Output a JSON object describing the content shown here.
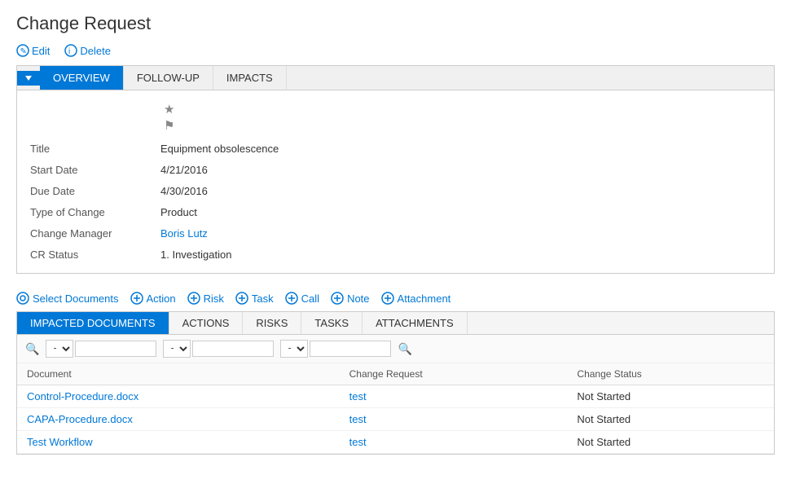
{
  "page": {
    "title": "Change Request"
  },
  "top_toolbar": {
    "edit_label": "Edit",
    "delete_label": "Delete"
  },
  "tabs": [
    {
      "id": "overview",
      "label": "OVERVIEW",
      "active": true
    },
    {
      "id": "followup",
      "label": "FOLLOW-UP",
      "active": false
    },
    {
      "id": "impacts",
      "label": "IMPACTS",
      "active": false
    }
  ],
  "overview": {
    "fields": [
      {
        "label": "Title",
        "value": "Equipment obsolescence",
        "type": "text"
      },
      {
        "label": "Start Date",
        "value": "4/21/2016",
        "type": "text"
      },
      {
        "label": "Due Date",
        "value": "4/30/2016",
        "type": "text"
      },
      {
        "label": "Type of Change",
        "value": "Product",
        "type": "text"
      },
      {
        "label": "Change Manager",
        "value": "Boris Lutz",
        "type": "link"
      },
      {
        "label": "CR Status",
        "value": "1. Investigation",
        "type": "text"
      }
    ]
  },
  "action_bar": {
    "select_documents_label": "Select Documents",
    "action_label": "Action",
    "risk_label": "Risk",
    "task_label": "Task",
    "call_label": "Call",
    "note_label": "Note",
    "attachment_label": "Attachment"
  },
  "sub_tabs": [
    {
      "id": "impacted",
      "label": "IMPACTED DOCUMENTS",
      "active": true
    },
    {
      "id": "actions",
      "label": "ACTIONS",
      "active": false
    },
    {
      "id": "risks",
      "label": "RISKS",
      "active": false
    },
    {
      "id": "tasks",
      "label": "TASKS",
      "active": false
    },
    {
      "id": "attachments",
      "label": "ATTACHMENTS",
      "active": false
    }
  ],
  "table": {
    "columns": [
      "Document",
      "Change Request",
      "Change Status"
    ],
    "filter_placeholder": "",
    "rows": [
      {
        "document": "Control-Procedure.docx",
        "change_request": "test",
        "change_status": "Not Started"
      },
      {
        "document": "CAPA-Procedure.docx",
        "change_request": "test",
        "change_status": "Not Started"
      },
      {
        "document": "Test Workflow",
        "change_request": "test",
        "change_status": "Not Started"
      }
    ]
  },
  "icons": {
    "star": "★",
    "flag": "⚑",
    "search": "🔍",
    "pencil": "✎",
    "trash": "🗑",
    "plus": "+",
    "select_docs": "⊙",
    "chevron": "▼"
  }
}
